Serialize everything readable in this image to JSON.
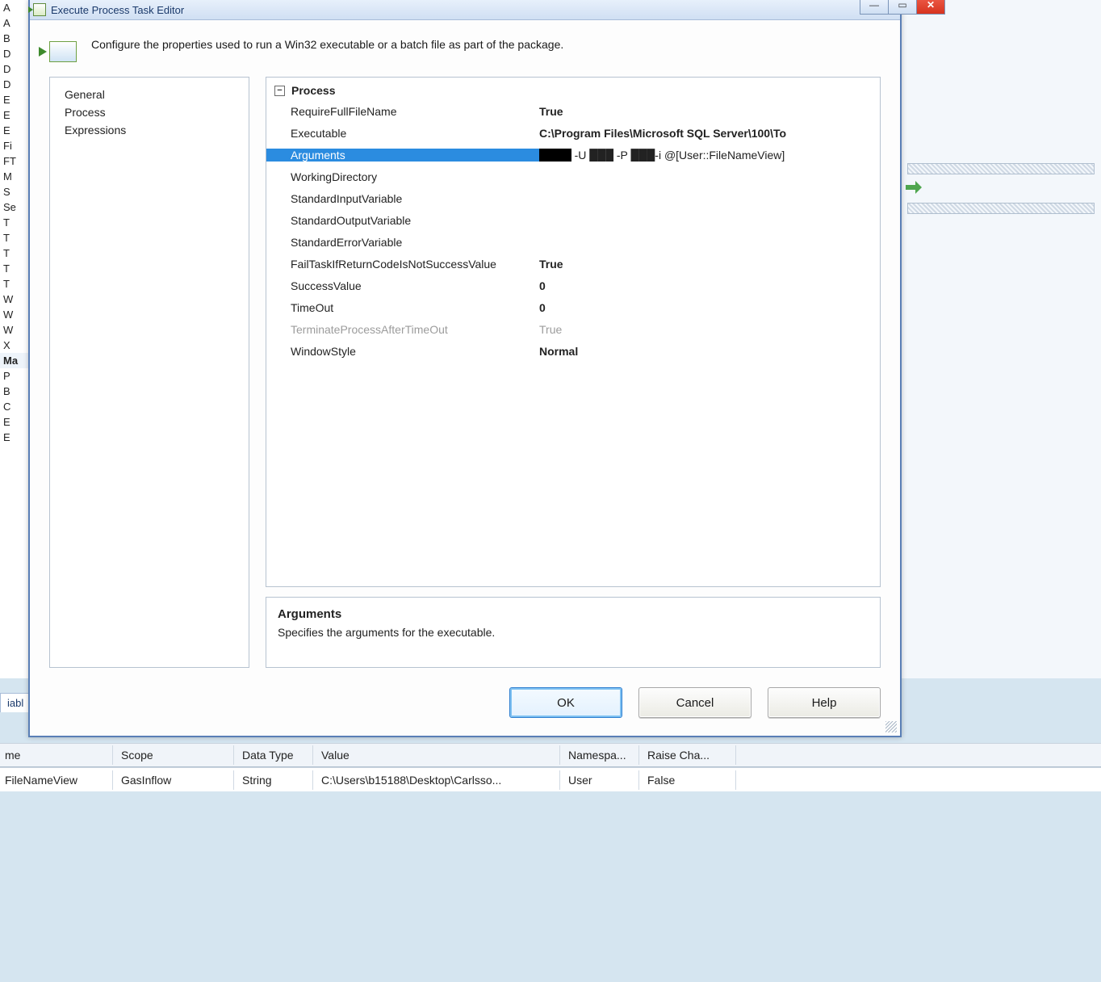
{
  "window": {
    "title": "Execute Process Task Editor",
    "description": "Configure the properties used to run a Win32 executable or a batch file as part of the package."
  },
  "nav": {
    "items": [
      "General",
      "Process",
      "Expressions"
    ]
  },
  "grid": {
    "header": "Process",
    "rows": [
      {
        "label": "RequireFullFileName",
        "value": "True",
        "bold": true
      },
      {
        "label": "Executable",
        "value": "C:\\Program Files\\Microsoft SQL Server\\100\\To",
        "bold": true
      },
      {
        "label": "Arguments",
        "value_prefix": "",
        "value_suffix": " -U ███ -P ███-i @[User::FileNameView]",
        "selected": true
      },
      {
        "label": "WorkingDirectory",
        "value": ""
      },
      {
        "label": "StandardInputVariable",
        "value": ""
      },
      {
        "label": "StandardOutputVariable",
        "value": ""
      },
      {
        "label": "StandardErrorVariable",
        "value": ""
      },
      {
        "label": "FailTaskIfReturnCodeIsNotSuccessValue",
        "value": "True",
        "bold": true
      },
      {
        "label": "SuccessValue",
        "value": "0",
        "bold": true
      },
      {
        "label": "TimeOut",
        "value": "0",
        "bold": true
      },
      {
        "label": "TerminateProcessAfterTimeOut",
        "value": "True",
        "disabled": true
      },
      {
        "label": "WindowStyle",
        "value": "Normal",
        "bold": true
      }
    ]
  },
  "desc": {
    "title": "Arguments",
    "text": "Specifies the arguments for the executable."
  },
  "buttons": {
    "ok": "OK",
    "cancel": "Cancel",
    "help": "Help"
  },
  "vars": {
    "headers": [
      "me",
      "Scope",
      "Data Type",
      "Value",
      "Namespa...",
      "Raise Cha..."
    ],
    "row": [
      "FileNameView",
      "GasInflow",
      "String",
      "C:\\Users\\b15188\\Desktop\\Carlsso...",
      "User",
      "False"
    ]
  },
  "bg": {
    "items": [
      "A",
      "A",
      "B",
      "D",
      "D",
      "D",
      "E",
      "E",
      "E",
      "Fi",
      "FT",
      "M",
      "S",
      "Se",
      "T",
      "T",
      "T",
      "T",
      "T",
      "W",
      "W",
      "W",
      "X",
      "Ma",
      "P",
      "B",
      "C",
      "E",
      "E"
    ],
    "tab": "iabl"
  }
}
